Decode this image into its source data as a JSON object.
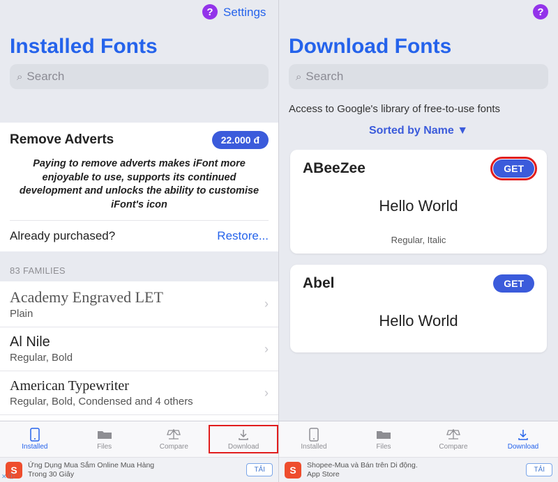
{
  "left": {
    "settings_label": "Settings",
    "title": "Installed Fonts",
    "search_placeholder": "Search",
    "promo": {
      "title": "Remove Adverts",
      "price": "22.000 đ",
      "body": "Paying to remove adverts makes iFont more enjoyable to use, supports its continued development and unlocks the ability to customise iFont's icon",
      "already_label": "Already purchased?",
      "restore_label": "Restore..."
    },
    "section_header": "83 FAMILIES",
    "fonts": [
      {
        "name": "Academy Engraved LET",
        "styles": "Plain"
      },
      {
        "name": "Al Nile",
        "styles": "Regular, Bold"
      },
      {
        "name": "American Typewriter",
        "styles": "Regular, Bold, Condensed and 4 others"
      }
    ]
  },
  "right": {
    "title": "Download Fonts",
    "search_placeholder": "Search",
    "access_text": "Access to Google's library of free-to-use fonts",
    "sort_label": "Sorted by Name ▼",
    "downloads": [
      {
        "name": "ABeeZee",
        "button": "GET",
        "preview": "Hello World",
        "styles": "Regular, Italic",
        "highlight": true
      },
      {
        "name": "Abel",
        "button": "GET",
        "preview": "Hello World",
        "styles": "",
        "highlight": false
      }
    ]
  },
  "tabs": [
    {
      "label": "Installed"
    },
    {
      "label": "Files"
    },
    {
      "label": "Compare"
    },
    {
      "label": "Download"
    }
  ],
  "ads": {
    "left_line1": "Ứng Dụng Mua Sắm Online Mua Hàng",
    "left_line2": "Trong 30 Giây",
    "right_line1": "Shopee-Mua và Bán trên Di động.",
    "right_line2": "App Store",
    "button": "TẢI"
  }
}
